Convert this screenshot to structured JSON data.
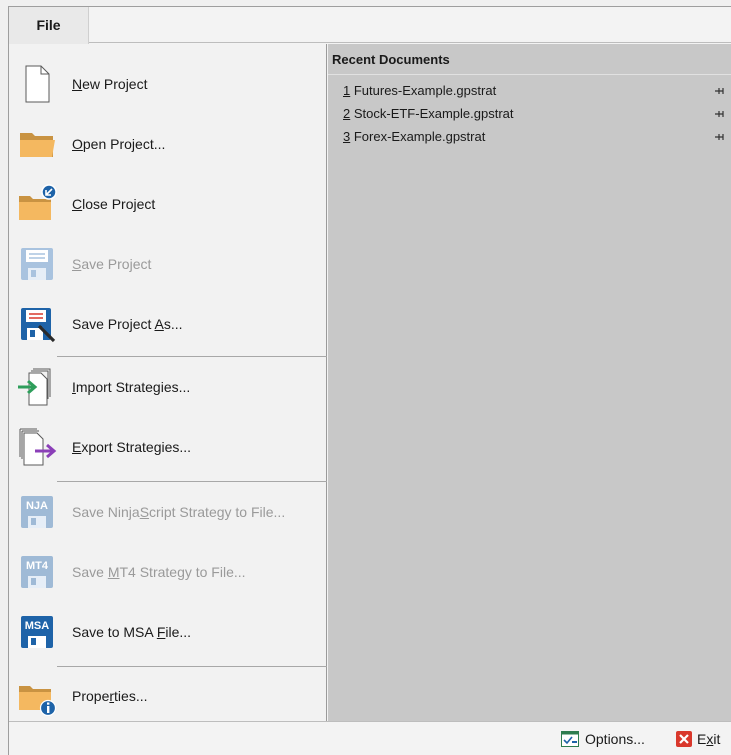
{
  "file_tab": {
    "label": "File"
  },
  "menu": {
    "items": [
      {
        "pre": "",
        "key": "N",
        "post": "ew Project",
        "disabled": false,
        "icon": "new-document-icon"
      },
      {
        "pre": "",
        "key": "O",
        "post": "pen Project...",
        "disabled": false,
        "icon": "open-folder-icon"
      },
      {
        "pre": "",
        "key": "C",
        "post": "lose Project",
        "disabled": false,
        "icon": "close-folder-icon"
      },
      {
        "pre": "",
        "key": "S",
        "post": "ave Project",
        "disabled": true,
        "icon": "save-icon"
      },
      {
        "pre": "Save Project ",
        "key": "A",
        "post": "s...",
        "disabled": false,
        "icon": "save-as-icon"
      },
      {
        "pre": "",
        "key": "I",
        "post": "mport Strategies...",
        "disabled": false,
        "icon": "import-icon"
      },
      {
        "pre": "",
        "key": "E",
        "post": "xport Strategies...",
        "disabled": false,
        "icon": "export-icon"
      },
      {
        "pre": "Save Ninja",
        "key": "S",
        "post": "cript Strategy to File...",
        "disabled": true,
        "icon": "nja-icon",
        "badge": "NJA"
      },
      {
        "pre": "Save ",
        "key": "M",
        "post": "T4 Strategy to File...",
        "disabled": true,
        "icon": "mt4-icon",
        "badge": "MT4"
      },
      {
        "pre": "Save to MSA ",
        "key": "F",
        "post": "ile...",
        "disabled": false,
        "icon": "msa-icon",
        "badge": "MSA"
      },
      {
        "pre": "Prope",
        "key": "r",
        "post": "ties...",
        "disabled": false,
        "icon": "properties-icon"
      }
    ]
  },
  "recent": {
    "header": "Recent Documents",
    "items": [
      {
        "num": "1",
        "name": " Futures-Example.gpstrat"
      },
      {
        "num": "2",
        "name": " Stock-ETF-Example.gpstrat"
      },
      {
        "num": "3",
        "name": " Forex-Example.gpstrat"
      }
    ]
  },
  "bottom": {
    "options_label": "Options...",
    "exit_pre": "E",
    "exit_key": "x",
    "exit_post": "it"
  },
  "colors": {
    "folder": "#f4b860",
    "badge_active": "#1e63a8",
    "badge_disabled": "#9fbad6",
    "import_arrow": "#2e9e5b",
    "export_arrow": "#8b3fb8",
    "exit_red": "#d9382c"
  }
}
